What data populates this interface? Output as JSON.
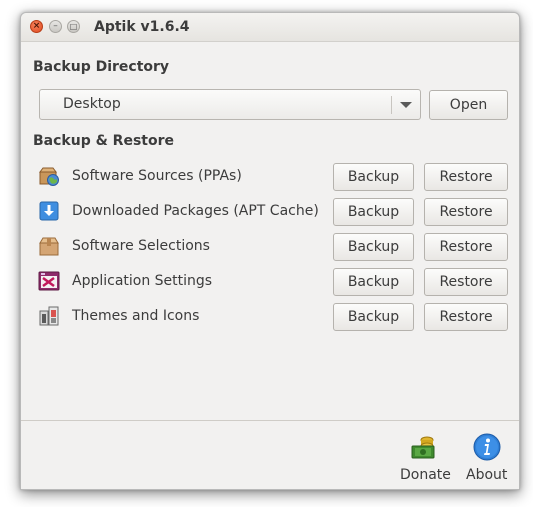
{
  "window": {
    "title": "Aptik v1.6.4"
  },
  "backup_directory": {
    "heading": "Backup Directory",
    "selected": "Desktop",
    "open_label": "Open"
  },
  "backup_restore": {
    "heading": "Backup & Restore",
    "backup_label": "Backup",
    "restore_label": "Restore",
    "items": [
      {
        "label": "Software Sources (PPAs)",
        "icon": "globe-package-icon"
      },
      {
        "label": "Downloaded Packages (APT Cache)",
        "icon": "download-arrow-icon"
      },
      {
        "label": "Software Selections",
        "icon": "package-box-icon"
      },
      {
        "label": "Application Settings",
        "icon": "application-settings-icon"
      },
      {
        "label": "Themes and Icons",
        "icon": "themes-paint-icon"
      }
    ]
  },
  "footer": {
    "donate_label": "Donate",
    "about_label": "About"
  }
}
